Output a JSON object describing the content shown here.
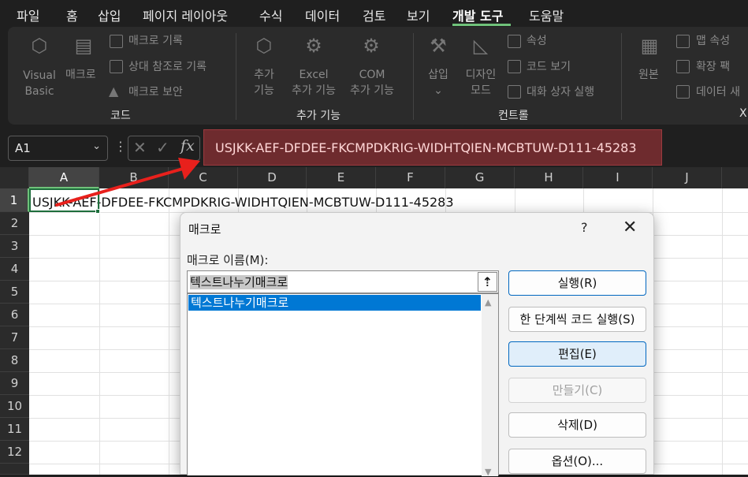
{
  "menu": {
    "tabs": [
      "파일",
      "홈",
      "삽입",
      "페이지 레이아웃",
      "수식",
      "데이터",
      "검토",
      "보기",
      "개발 도구",
      "도움말"
    ],
    "active": "개발 도구"
  },
  "ribbon": {
    "code": {
      "visual_basic_1": "Visual",
      "visual_basic_2": "Basic",
      "macro": "매크로",
      "record_macro": "매크로 기록",
      "relative_ref": "상대 참조로 기록",
      "macro_security": "매크로 보안",
      "group": "코드"
    },
    "addins": {
      "addins_1": "추가",
      "addins_2": "기능",
      "excel_1": "Excel",
      "excel_2": "추가 기능",
      "com_1": "COM",
      "com_2": "추가 기능",
      "group": "추가 기능"
    },
    "controls": {
      "insert": "삽입",
      "insert_chev": "⌄",
      "design_1": "디자인",
      "design_2": "모드",
      "properties": "속성",
      "view_code": "코드 보기",
      "run_dialog": "대화 상자 실행",
      "group": "컨트롤"
    },
    "xml": {
      "source": "원본",
      "map_props": "맵 속성",
      "expansion": "확장 팩",
      "refresh_data": "데이터 새",
      "group": "X"
    }
  },
  "formula_bar": {
    "name_box": "A1",
    "fx": "fx",
    "formula": "USJKK-AEF-DFDEE-FKCMPDKRIG-WIDHTQIEN-MCBTUW-D111-45283"
  },
  "grid": {
    "columns": [
      "A",
      "B",
      "C",
      "D",
      "E",
      "F",
      "G",
      "H",
      "I",
      "J"
    ],
    "rows": [
      "1",
      "2",
      "3",
      "4",
      "5",
      "6",
      "7",
      "8",
      "9",
      "10",
      "11",
      "12"
    ],
    "a1_value": "USJKK-AEF-DFDEE-FKCMPDKRIG-WIDHTQIEN-MCBTUW-D111-45283"
  },
  "dialog": {
    "title": "매크로",
    "help": "?",
    "close": "✕",
    "name_label": "매크로 이름(M):",
    "name_value": "텍스트나누기매크로",
    "list": [
      "텍스트나누기매크로"
    ],
    "buttons": {
      "run": "실행(R)",
      "step": "한 단계씩 코드 실행(S)",
      "edit": "편집(E)",
      "create": "만들기(C)",
      "delete": "삭제(D)",
      "options": "옵션(O)..."
    }
  },
  "colors": {
    "accent": "#6fc27a",
    "formula_highlight": "#6e2b2e",
    "selection": "#0078d4",
    "arrow": "#e8201c"
  }
}
